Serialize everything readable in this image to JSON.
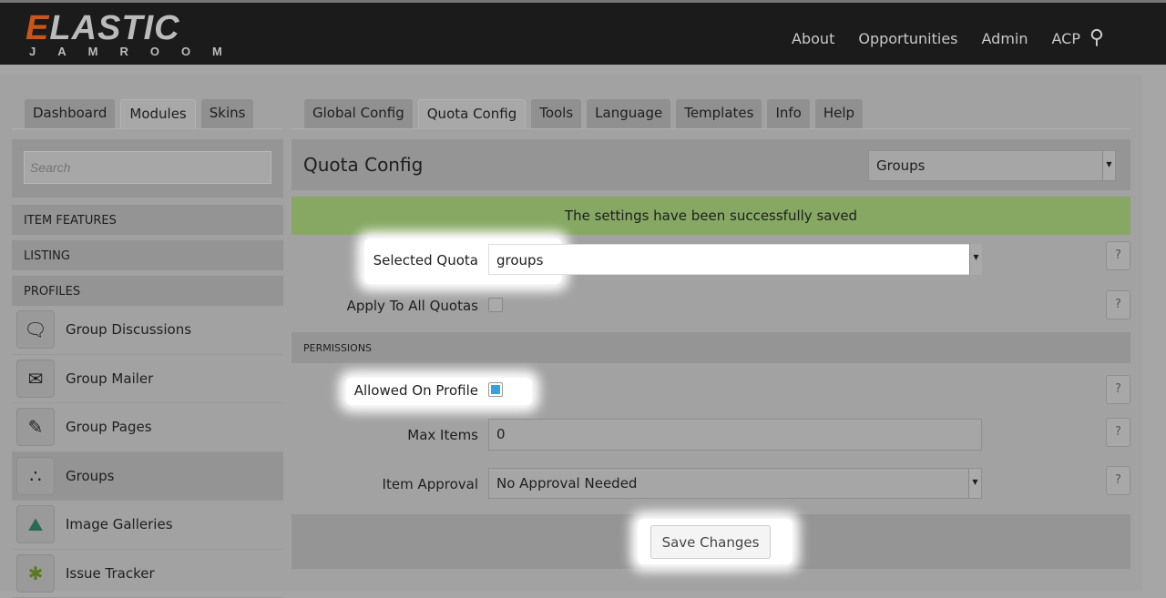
{
  "header": {
    "logo_top": "ELASTIC",
    "logo_first": "E",
    "logo_rest": "LASTIC",
    "logo_bottom": "JAMROOM",
    "nav": [
      "About",
      "Opportunities",
      "Admin",
      "ACP"
    ],
    "search_icon": "search-icon"
  },
  "left_tabs": [
    "Dashboard",
    "Modules",
    "Skins"
  ],
  "right_tabs": [
    "Global Config",
    "Quota Config",
    "Tools",
    "Language",
    "Templates",
    "Info",
    "Help"
  ],
  "sidebar": {
    "search_placeholder": "Search",
    "categories": [
      "ITEM FEATURES",
      "LISTING",
      "PROFILES"
    ],
    "modules": [
      {
        "label": "Group Discussions",
        "icon": "chat-icon"
      },
      {
        "label": "Group Mailer",
        "icon": "mail-icon"
      },
      {
        "label": "Group Pages",
        "icon": "notepad-icon"
      },
      {
        "label": "Groups",
        "icon": "groups-icon"
      },
      {
        "label": "Image Galleries",
        "icon": "picture-icon"
      },
      {
        "label": "Issue Tracker",
        "icon": "bug-icon"
      }
    ]
  },
  "panel": {
    "title": "Quota Config",
    "group_select": "Groups",
    "success": "The settings have been successfully saved",
    "selected_quota_label": "Selected Quota",
    "selected_quota": "groups",
    "apply_all_label": "Apply To All Quotas",
    "permissions": "PERMISSIONS",
    "allowed_label": "Allowed On Profile",
    "max_items_label": "Max Items",
    "max_items": "0",
    "approval_label": "Item Approval",
    "approval": "No Approval Needed",
    "help": "?",
    "save": "Save Changes"
  }
}
